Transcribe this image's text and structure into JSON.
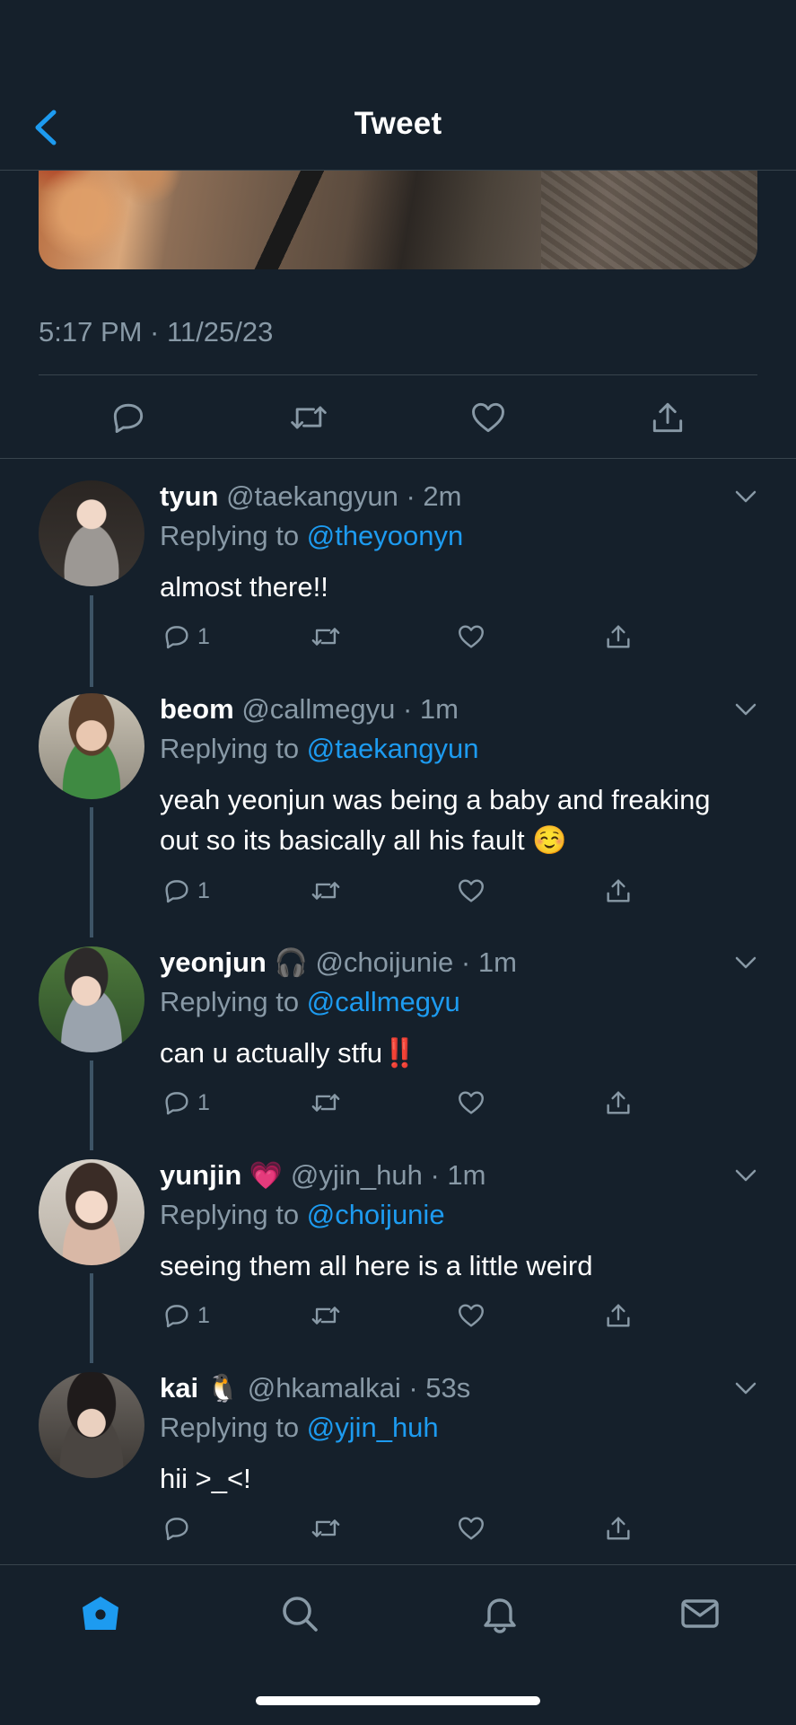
{
  "header": {
    "title": "Tweet"
  },
  "tweet": {
    "timestamp": "5:17 PM · 11/25/23"
  },
  "replies": [
    {
      "name": "tyun",
      "emoji": "",
      "handle": "@taekangyun",
      "time": "· 2m",
      "replying_prefix": "Replying to",
      "replying_to": "@theyoonyn",
      "text": "almost there!!",
      "reply_count": "1"
    },
    {
      "name": "beom",
      "emoji": "",
      "handle": "@callmegyu",
      "time": "· 1m",
      "replying_prefix": "Replying to",
      "replying_to": "@taekangyun",
      "text": "yeah yeonjun was being a baby and freaking out so its basically all his fault ☺️",
      "reply_count": "1"
    },
    {
      "name": "yeonjun",
      "emoji": "🎧",
      "handle": "@choijunie",
      "time": "· 1m",
      "replying_prefix": "Replying to",
      "replying_to": "@callmegyu",
      "text": "can u actually stfu‼️",
      "reply_count": "1"
    },
    {
      "name": "yunjin",
      "emoji": "💗",
      "handle": "@yjin_huh",
      "time": "· 1m",
      "replying_prefix": "Replying to",
      "replying_to": "@choijunie",
      "text": "seeing them all here is a little weird",
      "reply_count": "1"
    },
    {
      "name": "kai",
      "emoji": "🐧",
      "handle": "@hkamalkai",
      "time": "· 53s",
      "replying_prefix": "Replying to",
      "replying_to": "@yjin_huh",
      "text": "hii >_<!",
      "reply_count": ""
    }
  ],
  "colors": {
    "background": "#15202b",
    "accent": "#1d9bf0",
    "muted": "#8899a6",
    "divider": "#38444d"
  },
  "icons": {
    "header": "chevron-left-icon",
    "actions": [
      "reply-icon",
      "retweet-icon",
      "like-icon",
      "share-icon"
    ],
    "tabs": [
      "home-icon",
      "search-icon",
      "notifications-icon",
      "messages-icon"
    ]
  }
}
